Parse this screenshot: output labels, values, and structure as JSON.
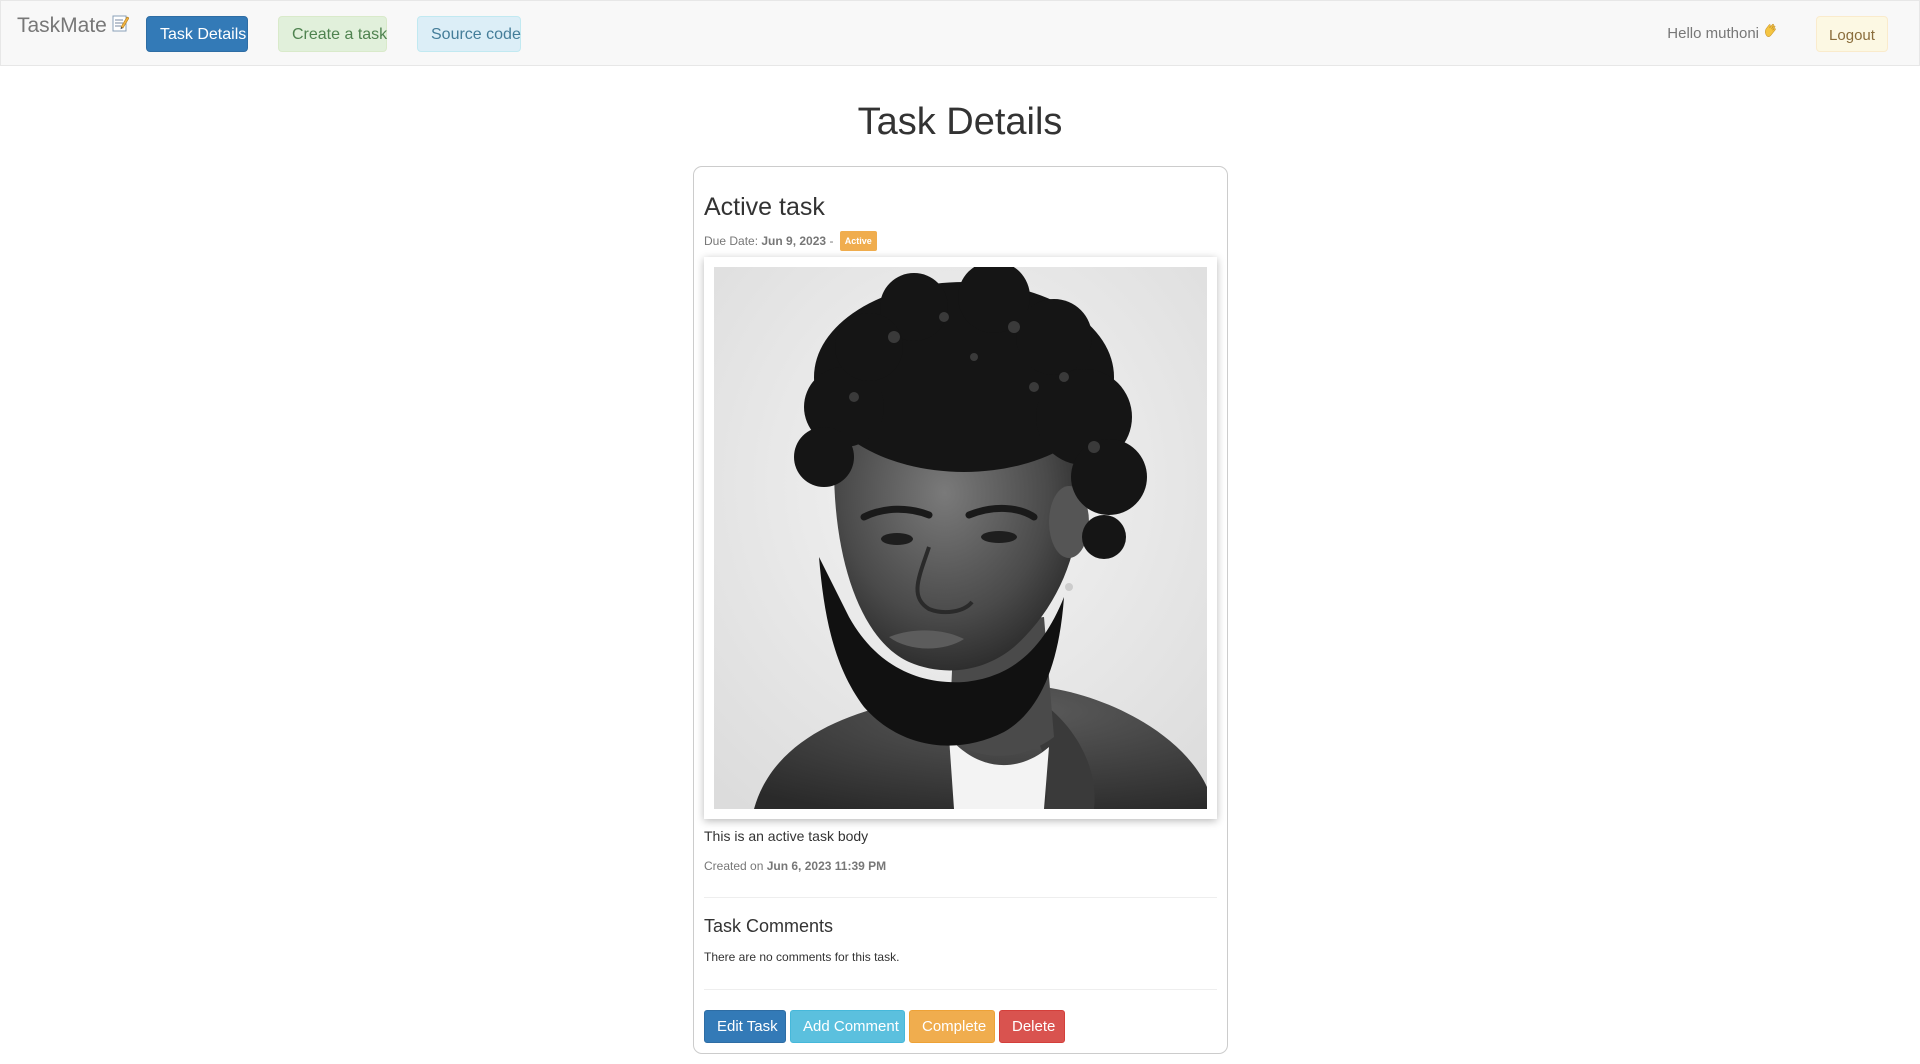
{
  "navbar": {
    "brand": "TaskMate",
    "brand_icon": "memo-icon",
    "task_details_label": "Task Details",
    "create_task_label": "Create a task",
    "source_code_label": "Source code",
    "greeting": "Hello muthoni",
    "greeting_icon": "waving-hand-icon",
    "logout_label": "Logout"
  },
  "main": {
    "page_title": "Task Details"
  },
  "task": {
    "title": "Active task",
    "due_prefix": "Due Date:",
    "due_date": "Jun 9, 2023",
    "due_separator": "-",
    "status_badge": "Active",
    "status_color": "#f0ad4e",
    "image_alt": "portrait-photo",
    "body": "This is an active task body",
    "created_prefix": "Created on",
    "created_at": "Jun 6, 2023 11:39 PM"
  },
  "comments": {
    "title": "Task Comments",
    "empty_text": "There are no comments for this task."
  },
  "actions": {
    "edit_label": "Edit Task",
    "add_comment_label": "Add Comment",
    "complete_label": "Complete",
    "delete_label": "Delete"
  },
  "colors": {
    "primary": "#337ab7",
    "info": "#5bc0de",
    "warning": "#f0ad4e",
    "danger": "#d9534f"
  }
}
